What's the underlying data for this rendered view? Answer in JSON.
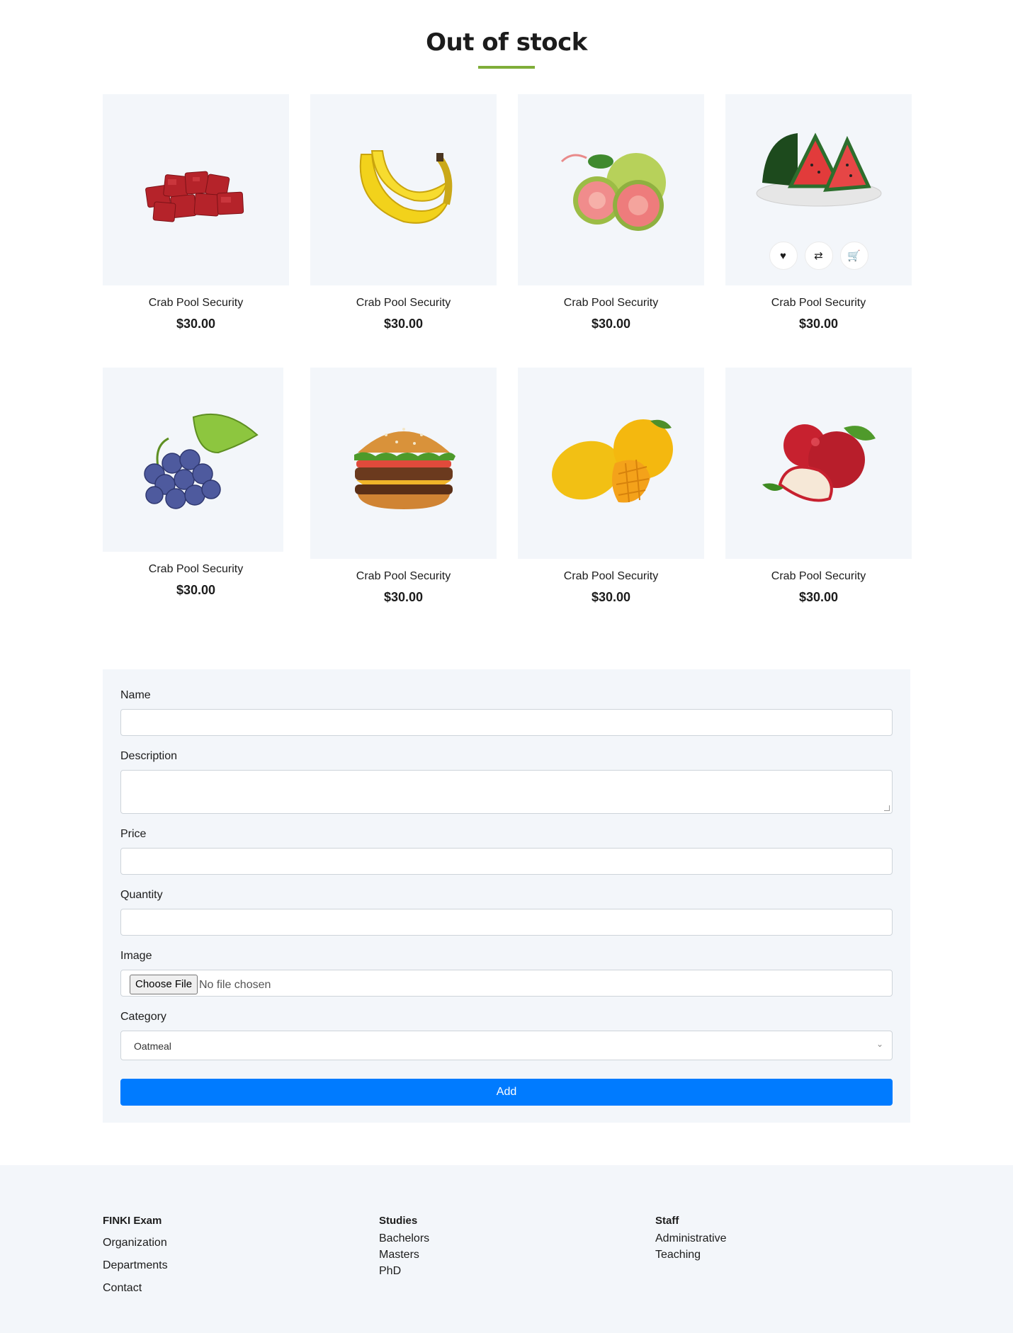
{
  "section": {
    "title": "Out of stock"
  },
  "products": [
    {
      "name": "Crab Pool Security",
      "price": "$30.00",
      "image": "meat-cubes"
    },
    {
      "name": "Crab Pool Security",
      "price": "$30.00",
      "image": "bananas"
    },
    {
      "name": "Crab Pool Security",
      "price": "$30.00",
      "image": "guava"
    },
    {
      "name": "Crab Pool Security",
      "price": "$30.00",
      "image": "watermelon"
    },
    {
      "name": "Crab Pool Security",
      "price": "$30.00",
      "image": "grapes"
    },
    {
      "name": "Crab Pool Security",
      "price": "$30.00",
      "image": "burger"
    },
    {
      "name": "Crab Pool Security",
      "price": "$30.00",
      "image": "mango"
    },
    {
      "name": "Crab Pool Security",
      "price": "$30.00",
      "image": "apples"
    }
  ],
  "product_hover_icons": [
    "heart-icon",
    "retweet-icon",
    "cart-icon"
  ],
  "form": {
    "name_label": "Name",
    "description_label": "Description",
    "price_label": "Price",
    "quantity_label": "Quantity",
    "image_label": "Image",
    "file_button": "Choose File",
    "file_status": "No file chosen",
    "category_label": "Category",
    "category_value": "Oatmeal",
    "submit_label": "Add"
  },
  "footer": {
    "col1": {
      "title": "FINKI Exam",
      "links": [
        "Organization",
        "Departments",
        "Contact"
      ]
    },
    "col2": {
      "title": "Studies",
      "links": [
        "Bachelors",
        "Masters",
        "PhD"
      ]
    },
    "col3": {
      "title": "Staff",
      "links": [
        "Administrative",
        "Teaching"
      ]
    }
  },
  "colors": {
    "accent": "#7fad39",
    "primary_button": "#007bff",
    "panel_bg": "#f3f6fa"
  }
}
